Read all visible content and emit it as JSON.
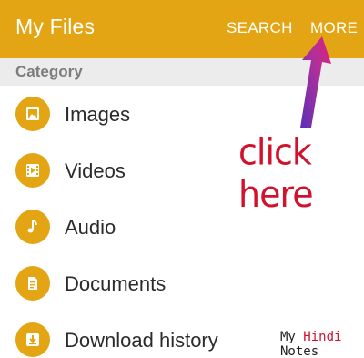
{
  "appbar": {
    "title": "My Files",
    "search_label": "SEARCH",
    "more_label": "MORE",
    "accent_color": "#e3a513"
  },
  "category": {
    "label": "Category"
  },
  "items": [
    {
      "label": "Images",
      "icon": "image-icon"
    },
    {
      "label": "Videos",
      "icon": "video-icon"
    },
    {
      "label": "Audio",
      "icon": "music-note-icon"
    },
    {
      "label": "Documents",
      "icon": "document-icon"
    },
    {
      "label": "Download history",
      "icon": "download-icon"
    }
  ],
  "annotation": {
    "text": "click here",
    "color": "#d1122c"
  },
  "watermark": {
    "part1": "My",
    "part2": "Hindi",
    "part3": "Notes"
  }
}
